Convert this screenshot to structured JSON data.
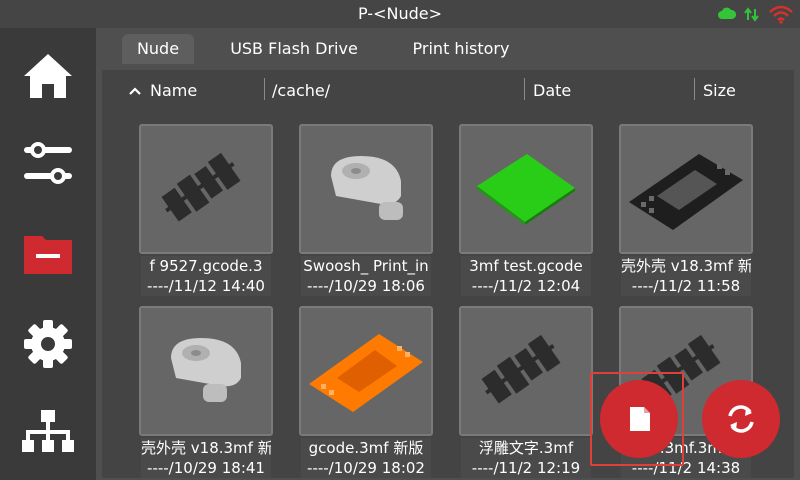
{
  "window": {
    "title": "P-<Nude>"
  },
  "status_icons": [
    "cloud-icon",
    "transfer-icon",
    "wifi-icon"
  ],
  "colors": {
    "accent": "#cf2a2f",
    "status_green": "#34c43a",
    "wifi_red": "#d9302c"
  },
  "sidebar": {
    "items": [
      {
        "icon": "home-icon"
      },
      {
        "icon": "sliders-icon"
      },
      {
        "icon": "folder-icon",
        "active": true
      },
      {
        "icon": "gear-icon"
      },
      {
        "icon": "network-icon"
      }
    ]
  },
  "tabs": [
    {
      "label": "Nude",
      "active": true
    },
    {
      "label": "USB Flash Drive"
    },
    {
      "label": "Print history"
    }
  ],
  "columns": {
    "name": "Name",
    "path": "/cache/",
    "date": "Date",
    "size": "Size"
  },
  "files": [
    {
      "name": "f   9527.gcode.3",
      "date": "----/11/12 14:40",
      "thumb": "text-relief"
    },
    {
      "name": "Swoosh_ Print_in",
      "date": "----/10/29 18:06",
      "thumb": "grey-part"
    },
    {
      "name": "3mf   test.gcode",
      "date": "----/11/2 12:04",
      "thumb": "green-plate"
    },
    {
      "name": "壳外壳 v18.3mf  新",
      "date": "----/11/2 11:58",
      "thumb": "black-case"
    },
    {
      "name": "壳外壳 v18.3mf  新",
      "date": "----/10/29 18:41",
      "thumb": "grey-part"
    },
    {
      "name": "gcode.3mf  新版",
      "date": "----/10/29 18:02",
      "thumb": "orange-case"
    },
    {
      "name": "浮雕文字.3mf",
      "date": "----/11/2 12:19",
      "thumb": "text-relief"
    },
    {
      "name": "字.3mf.3mf",
      "date": "----/11/2 14:38",
      "thumb": "text-relief"
    }
  ],
  "actions": [
    {
      "icon": "file-icon"
    },
    {
      "icon": "refresh-icon"
    }
  ]
}
